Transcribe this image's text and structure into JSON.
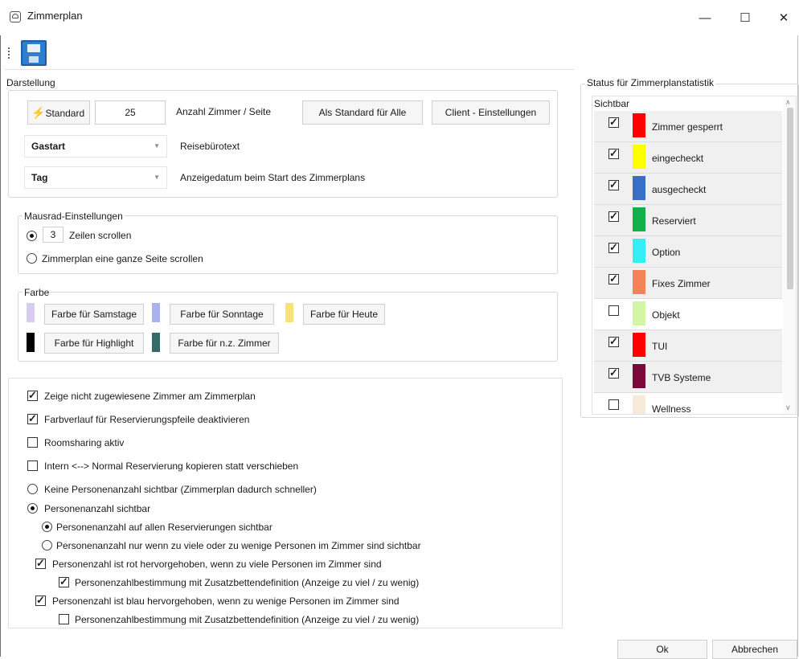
{
  "window": {
    "title": "Zimmerplan",
    "controls": {
      "minimize": "—",
      "maximize": "☐",
      "close": "✕"
    }
  },
  "toolbar": {
    "save_icon": "floppy-disk-icon"
  },
  "darstellung": {
    "legend": "Darstellung",
    "standard_button": "Standard",
    "rooms_per_page": "25",
    "rooms_per_page_label": "Anzahl Zimmer / Seite",
    "as_default_button": "Als Standard für Alle",
    "client_settings_button": "Client - Einstellungen",
    "reisebuero_combo": "Gastart",
    "reisebuero_label": "Reisebürotext",
    "date_combo": "Tag",
    "date_label": "Anzeigedatum beim Start des Zimmerplans"
  },
  "mausrad": {
    "legend": "Mausrad-Einstellungen",
    "rows_value": "3",
    "rows_label": "Zeilen scrollen",
    "page_option": "Zimmerplan eine ganze Seite scrollen"
  },
  "farbe": {
    "legend": "Farbe",
    "items": [
      {
        "label": "Farbe für Samstage",
        "color": "#d9ccf3"
      },
      {
        "label": "Farbe für Sonntage",
        "color": "#aab2f0"
      },
      {
        "label": "Farbe für Heute",
        "color": "#f7e27a"
      },
      {
        "label": "Farbe für Highlight",
        "color": "#000000"
      },
      {
        "label": "Farbe für n.z. Zimmer",
        "color": "#356a66"
      }
    ]
  },
  "options": [
    {
      "label": "Zeige nicht zugewiesene Zimmer am Zimmerplan",
      "type": "checkbox",
      "checked": true
    },
    {
      "label": "Farbverlauf für Reservierungspfeile deaktivieren",
      "type": "checkbox",
      "checked": true
    },
    {
      "label": "Roomsharing aktiv",
      "type": "checkbox",
      "checked": false
    },
    {
      "label": "Intern <--> Normal Reservierung kopieren statt verschieben",
      "type": "checkbox",
      "checked": false
    },
    {
      "label": "Keine Personenanzahl sichtbar (Zimmerplan dadurch schneller)",
      "type": "radio",
      "checked": false
    },
    {
      "label": "Personenanzahl sichtbar",
      "type": "radio",
      "checked": true
    },
    {
      "label": "Personenanzahl auf allen Reservierungen sichtbar",
      "type": "radio",
      "checked": true
    },
    {
      "label": "Personenanzahl nur wenn zu viele oder zu wenige Personen im Zimmer sind sichtbar",
      "type": "radio",
      "checked": false
    },
    {
      "label": "Personenzahl ist rot hervorgehoben, wenn zu viele Personen im Zimmer sind",
      "type": "checkbox",
      "checked": true
    },
    {
      "label": "Personenzahlbestimmung mit Zusatzbettendefinition (Anzeige zu viel / zu wenig)",
      "type": "checkbox",
      "checked": true
    },
    {
      "label": "Personenzahl ist blau hervorgehoben, wenn zu wenige Personen im Zimmer sind",
      "type": "checkbox",
      "checked": true
    },
    {
      "label": "Personenzahlbestimmung mit Zusatzbettendefinition (Anzeige zu viel / zu wenig)",
      "type": "checkbox",
      "checked": false
    }
  ],
  "status": {
    "legend": "Status für Zimmerplanstatistik",
    "column_header": "Sichtbar",
    "items": [
      {
        "label": "Zimmer gesperrt",
        "color": "#ff0000",
        "checked": true
      },
      {
        "label": "eingecheckt",
        "color": "#ffff00",
        "checked": true
      },
      {
        "label": "ausgecheckt",
        "color": "#3a6fc6",
        "checked": true
      },
      {
        "label": "Reserviert",
        "color": "#12b04a",
        "checked": true
      },
      {
        "label": "Option",
        "color": "#33eef5",
        "checked": true
      },
      {
        "label": "Fixes Zimmer",
        "color": "#f5835a",
        "checked": true
      },
      {
        "label": "Objekt",
        "color": "#d4f5a6",
        "checked": false
      },
      {
        "label": "TUI",
        "color": "#ff0000",
        "checked": true
      },
      {
        "label": "TVB Systeme",
        "color": "#7a0a3a",
        "checked": true
      },
      {
        "label": "Wellness",
        "color": "#f7ead8",
        "checked": false
      }
    ]
  },
  "footer": {
    "ok": "Ok",
    "cancel": "Abbrechen"
  }
}
